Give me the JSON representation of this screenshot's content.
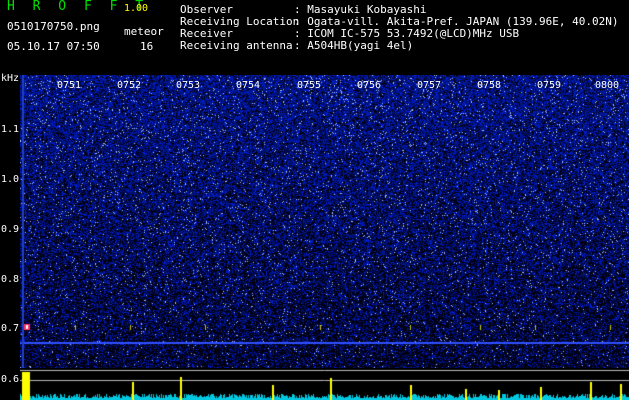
{
  "header": {
    "app_title": "H R O F F T",
    "app_version": "1.00",
    "file_name": "0510170750.png",
    "datetime": "05.10.17 07:50",
    "meteor_label": "meteor",
    "meteor_count": "16"
  },
  "info": [
    {
      "key": "Observer",
      "value": ": Masayuki Kobayashi"
    },
    {
      "key": "Receiving Location",
      "value": ": Ogata-vill. Akita-Pref. JAPAN (139.96E, 40.02N)"
    },
    {
      "key": "Receiver",
      "value": ": ICOM IC-575 53.7492(@LCD)MHz USB"
    },
    {
      "key": "Receiving antenna",
      "value": ": A504HB(yagi 4el)"
    }
  ],
  "axis": {
    "unit": "kHz",
    "y_labels": [
      "1.1",
      "1.0",
      "0.9",
      "0.8",
      "0.7",
      "0.6"
    ],
    "x_labels": [
      "0751",
      "0752",
      "0753",
      "0754",
      "0755",
      "0756",
      "0757",
      "0758",
      "0759",
      "0800"
    ]
  },
  "colors": {
    "background": "#000000",
    "noise": "#0a14a0",
    "carrier": "#3050ff",
    "lower_noise": "#00c8e0",
    "peaks": "#ffff00"
  }
}
